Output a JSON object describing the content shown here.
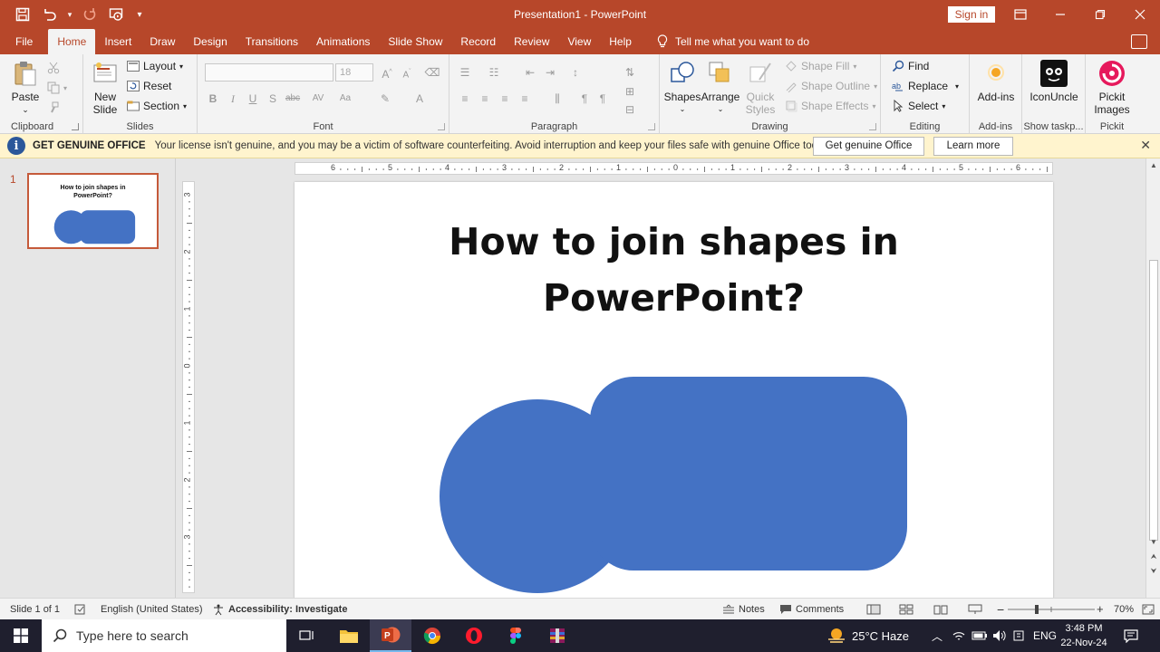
{
  "window": {
    "title": "Presentation1  -  PowerPoint",
    "sign_in": "Sign in"
  },
  "tabs": [
    "File",
    "Home",
    "Insert",
    "Draw",
    "Design",
    "Transitions",
    "Animations",
    "Slide Show",
    "Record",
    "Review",
    "View",
    "Help"
  ],
  "active_tab": "Home",
  "tell_me": "Tell me what you want to do",
  "ribbon": {
    "clipboard": {
      "label": "Clipboard",
      "paste": "Paste"
    },
    "slides": {
      "label": "Slides",
      "new_slide_1": "New",
      "new_slide_2": "Slide",
      "layout": "Layout",
      "reset": "Reset",
      "section": "Section"
    },
    "font": {
      "label": "Font",
      "size": "18"
    },
    "paragraph": {
      "label": "Paragraph"
    },
    "drawing": {
      "label": "Drawing",
      "shapes": "Shapes",
      "arrange": "Arrange",
      "quick_styles_1": "Quick",
      "quick_styles_2": "Styles",
      "shape_fill": "Shape Fill",
      "shape_outline": "Shape Outline",
      "shape_effects": "Shape Effects"
    },
    "editing": {
      "label": "Editing",
      "find": "Find",
      "replace": "Replace",
      "select": "Select"
    },
    "addins": {
      "label": "Add-ins",
      "button": "Add-ins"
    },
    "iconuncle": {
      "label": "Show taskp...",
      "button": "IconUncle"
    },
    "pickit": {
      "label": "Pickit",
      "button_1": "Pickit",
      "button_2": "Images"
    }
  },
  "notification": {
    "title": "GET GENUINE OFFICE",
    "message": "Your license isn't genuine, and you may be a victim of software counterfeiting. Avoid interruption and keep your files safe with genuine Office today.",
    "primary_button": "Get genuine Office",
    "secondary_button": "Learn more"
  },
  "thumbnails": [
    {
      "number": "1",
      "title": "How to join shapes in PowerPoint?"
    }
  ],
  "slide": {
    "title_line1": "How to join shapes in",
    "title_line2": "PowerPoint?",
    "shape_color": "#4472c4"
  },
  "rulers": {
    "horizontal": [
      "6",
      "5",
      "4",
      "3",
      "2",
      "1",
      "0",
      "1",
      "2",
      "3",
      "4",
      "5",
      "6"
    ],
    "vertical": [
      "3",
      "2",
      "1",
      "0",
      "1",
      "2",
      "3"
    ]
  },
  "statusbar": {
    "slide_count": "Slide 1 of 1",
    "language": "English (United States)",
    "accessibility": "Accessibility: Investigate",
    "notes": "Notes",
    "comments": "Comments",
    "zoom": "70%"
  },
  "taskbar": {
    "search_placeholder": "Type here to search",
    "weather": "25°C  Haze",
    "language": "ENG",
    "time": "3:48 PM",
    "date": "22-Nov-24"
  },
  "colors": {
    "accent": "#b7472a",
    "shape": "#4472c4",
    "notification_bg": "#fff4ce"
  }
}
